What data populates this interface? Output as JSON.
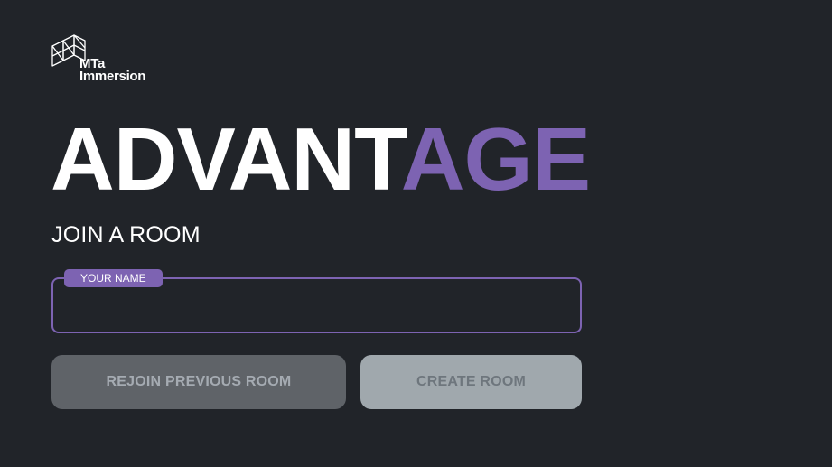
{
  "brand": {
    "logo_icon": "wireframe-cube-icon",
    "name_line1": "MTa",
    "name_line2": "Immersion"
  },
  "title": {
    "part1": "ADVANT",
    "part2": "AGE",
    "accent_color": "#7d63b2"
  },
  "subtitle": "JOIN A ROOM",
  "name_field": {
    "label": "YOUR NAME",
    "value": "",
    "placeholder": ""
  },
  "buttons": {
    "rejoin_label": "REJOIN PREVIOUS ROOM",
    "create_label": "CREATE ROOM"
  },
  "colors": {
    "background": "#212429",
    "accent": "#7d63b2"
  }
}
